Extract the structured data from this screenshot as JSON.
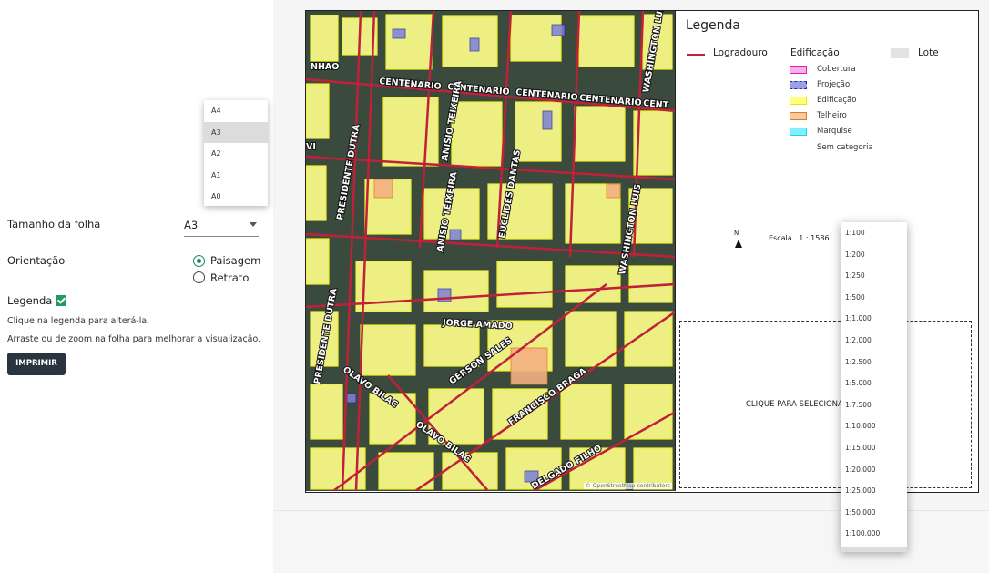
{
  "settings": {
    "sheet_size_label": "Tamanho da folha",
    "sheet_size_value": "A3",
    "sheet_size_options": [
      "A4",
      "A3",
      "A2",
      "A1",
      "A0"
    ],
    "orientation_label": "Orientação",
    "orientation_options": [
      "Paisagem",
      "Retrato"
    ],
    "legend_label": "Legenda",
    "hint_legend": "Clique na legenda para alterá-la.",
    "hint_zoom": "Arraste ou de zoom na folha para melhorar a visualização.",
    "print_button": "IMPRIMIR"
  },
  "map": {
    "attribution": "© OpenStreetMap contributors",
    "streets": [
      "CENTENARIO",
      "CENTENARIO",
      "CENTENARIO",
      "CENTENARIO",
      "CENT",
      "WASHINGTON LUIS",
      "ANISIO TEIXEIRA",
      "EUCLIDES DANTAS",
      "JORGE AMADO",
      "GERSON SALES",
      "FRANCISCO BRAGA",
      "OLAVO BILAC",
      "OLAVO BILAC",
      "PRESIDENTE DUTRA",
      "PRESIDENTE DUTRA",
      "WASHINGTON LUIS",
      "ANISIO TEIXEIRA",
      "DELGADO FILHO",
      "NHAO",
      "VI"
    ]
  },
  "legend": {
    "title": "Legenda",
    "logradouro": "Logradouro",
    "edificacao": "Edificação",
    "lote": "Lote",
    "items": [
      {
        "label": "Cobertura",
        "color": "#f9b0e8",
        "border": "#e020b0"
      },
      {
        "label": "Projeção",
        "color": "#9aa0e8",
        "border": "#2a2aa0"
      },
      {
        "label": "Edificação",
        "color": "#ffff80",
        "border": "#e8e800"
      },
      {
        "label": "Telheiro",
        "color": "#f8c8a0",
        "border": "#e07a20"
      },
      {
        "label": "Marquise",
        "color": "#80f0ff",
        "border": "#20d0e8"
      },
      {
        "label": "Sem categoria",
        "color": "",
        "border": ""
      }
    ],
    "north": "N",
    "scale_prefix": "Escala",
    "scale_value": "1 : 1586",
    "select_box": "CLIQUE PARA SELECIONAR"
  },
  "scale_options": [
    "1:100",
    "1:200",
    "1:250",
    "1:500",
    "1:1.000",
    "1:2.000",
    "1:2.500",
    "1:5.000",
    "1:7.500",
    "1:10.000",
    "1:15.000",
    "1:20.000",
    "1:25.000",
    "1:50.000",
    "1:100.000"
  ],
  "colors": {
    "accent": "#1e9b5e",
    "button_bg": "#2a3440",
    "street_line": "#c0203a"
  }
}
